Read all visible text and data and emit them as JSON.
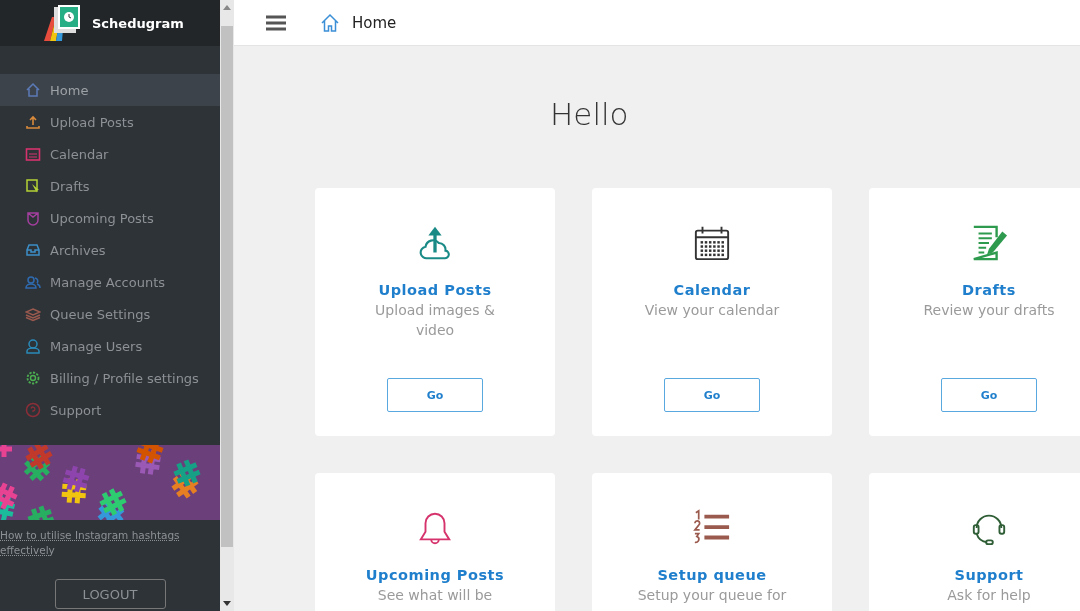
{
  "sidebar": {
    "brand": "Schedugram",
    "items": [
      {
        "label": "Home",
        "selected": true
      },
      {
        "label": "Upload Posts",
        "selected": false
      },
      {
        "label": "Calendar",
        "selected": false
      },
      {
        "label": "Drafts",
        "selected": false
      },
      {
        "label": "Upcoming Posts",
        "selected": false
      },
      {
        "label": "Archives",
        "selected": false
      },
      {
        "label": "Manage Accounts",
        "selected": false
      },
      {
        "label": "Queue Settings",
        "selected": false
      },
      {
        "label": "Manage Users",
        "selected": false
      },
      {
        "label": "Billing / Profile settings",
        "selected": false
      },
      {
        "label": "Support",
        "selected": false
      }
    ],
    "promo": {
      "kind": "picture",
      "link": "How to utilise Instagram hashtags effectively"
    },
    "logout": "LOGOUT"
  },
  "header": {
    "title": "Home"
  },
  "greeting": "Hello",
  "cards": [
    {
      "title": "Upload Posts",
      "description": "Upload images & video",
      "button": "Go"
    },
    {
      "title": "Calendar",
      "description": "View your calendar",
      "button": "Go"
    },
    {
      "title": "Drafts",
      "description": "Review your drafts",
      "button": "Go"
    },
    {
      "title": "Upcoming Posts",
      "description": "See what will be"
    },
    {
      "title": "Setup queue",
      "description": "Setup your queue for"
    },
    {
      "title": "Support",
      "description": "Ask for help"
    }
  ]
}
